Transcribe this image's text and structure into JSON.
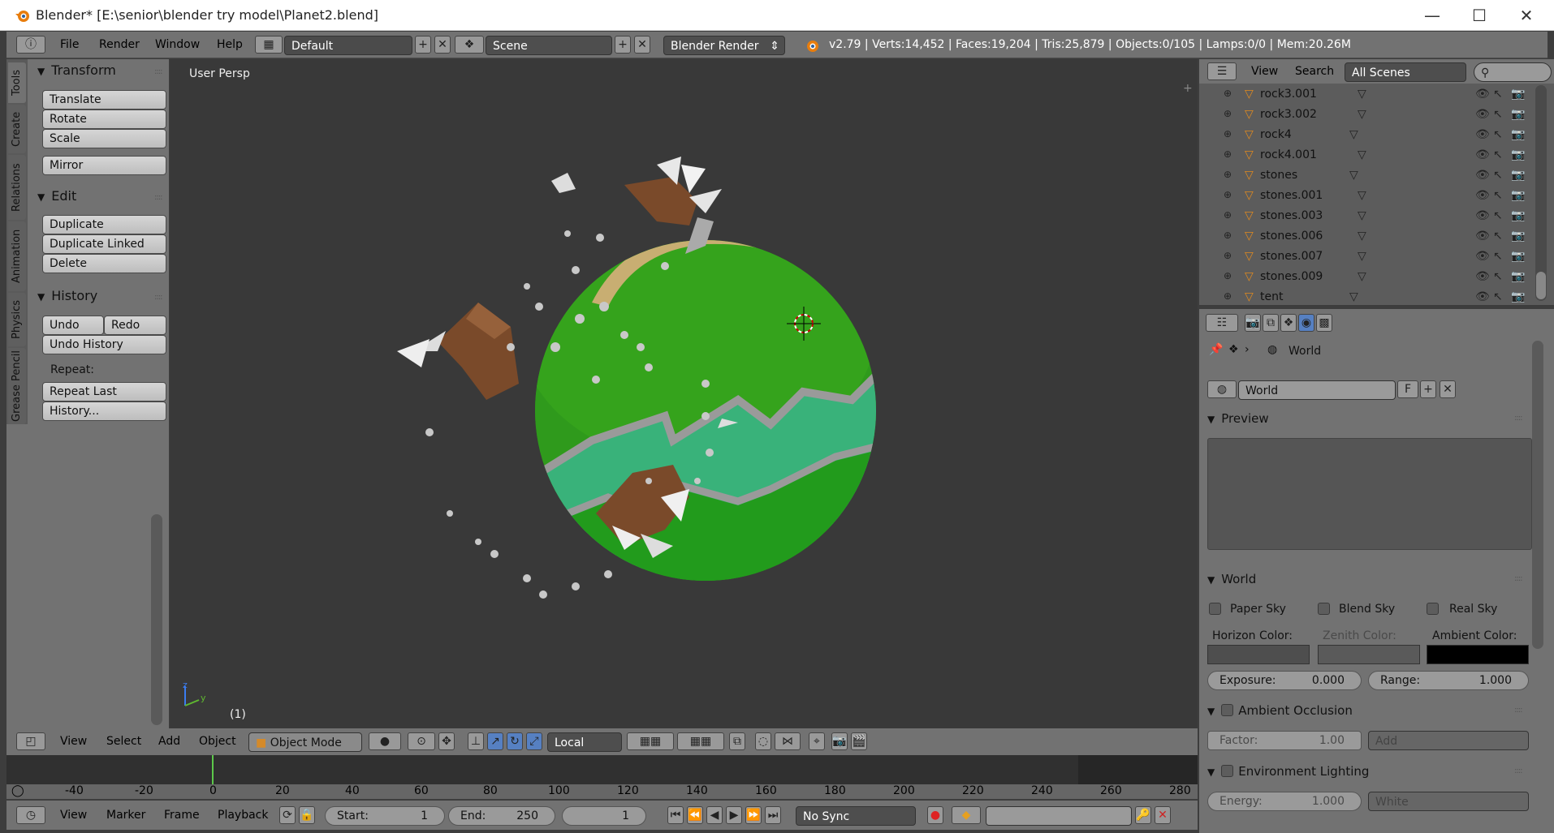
{
  "window": {
    "title": "Blender* [E:\\senior\\blender try model\\Planet2.blend]",
    "minimize": "—",
    "maximize": "☐",
    "close": "✕"
  },
  "info_header": {
    "menus": [
      "File",
      "Render",
      "Window",
      "Help"
    ],
    "layout": "Default",
    "scene": "Scene",
    "engine": "Blender Render",
    "stats": "v2.79 | Verts:14,452 | Faces:19,204 | Tris:25,879 | Objects:0/105 | Lamps:0/0 | Mem:20.26M"
  },
  "tool_tabs": [
    "Tools",
    "Create",
    "Relations",
    "Animation",
    "Physics",
    "Grease Pencil"
  ],
  "tool_shelf": {
    "transform": {
      "title": "Transform",
      "buttons": [
        "Translate",
        "Rotate",
        "Scale",
        "Mirror"
      ]
    },
    "edit": {
      "title": "Edit",
      "buttons": [
        "Duplicate",
        "Duplicate Linked",
        "Delete"
      ]
    },
    "history": {
      "title": "History",
      "undo": "Undo",
      "redo": "Redo",
      "undo_history": "Undo History",
      "repeat_label": "Repeat:",
      "repeat_last": "Repeat Last",
      "history_btn": "History..."
    }
  },
  "viewport": {
    "label": "User Persp",
    "frame": "(1)",
    "axis_z": "z",
    "axis_y": "y"
  },
  "view3d_header": {
    "menus": [
      "View",
      "Select",
      "Add",
      "Object"
    ],
    "mode": "Object Mode",
    "orientation": "Local"
  },
  "timeline": {
    "ruler": [
      "-40",
      "-20",
      "0",
      "20",
      "40",
      "60",
      "80",
      "100",
      "120",
      "140",
      "160",
      "180",
      "200",
      "220",
      "240",
      "260",
      "280"
    ],
    "menus": [
      "View",
      "Marker",
      "Frame",
      "Playback"
    ],
    "start_label": "Start:",
    "start": "1",
    "end_label": "End:",
    "end": "250",
    "current": "1",
    "sync": "No Sync"
  },
  "outliner": {
    "menus": [
      "View",
      "Search"
    ],
    "filter": "All Scenes",
    "items": [
      "rock3.001",
      "rock3.002",
      "rock4",
      "rock4.001",
      "stones",
      "stones.001",
      "stones.003",
      "stones.006",
      "stones.007",
      "stones.009",
      "tent"
    ]
  },
  "properties": {
    "breadcrumb": "World",
    "world_name": "World",
    "fake_user": "F",
    "preview_title": "Preview",
    "world_title": "World",
    "paper_sky": "Paper Sky",
    "blend_sky": "Blend Sky",
    "real_sky": "Real Sky",
    "horizon_color": "Horizon Color:",
    "zenith_color": "Zenith Color:",
    "ambient_color": "Ambient Color:",
    "exposure_label": "Exposure:",
    "exposure": "0.000",
    "range_label": "Range:",
    "range": "1.000",
    "ao_title": "Ambient Occlusion",
    "factor_label": "Factor:",
    "factor": "1.00",
    "ao_blend": "Add",
    "env_title": "Environment Lighting",
    "energy_label": "Energy:",
    "energy": "1.000",
    "env_color": "White"
  }
}
